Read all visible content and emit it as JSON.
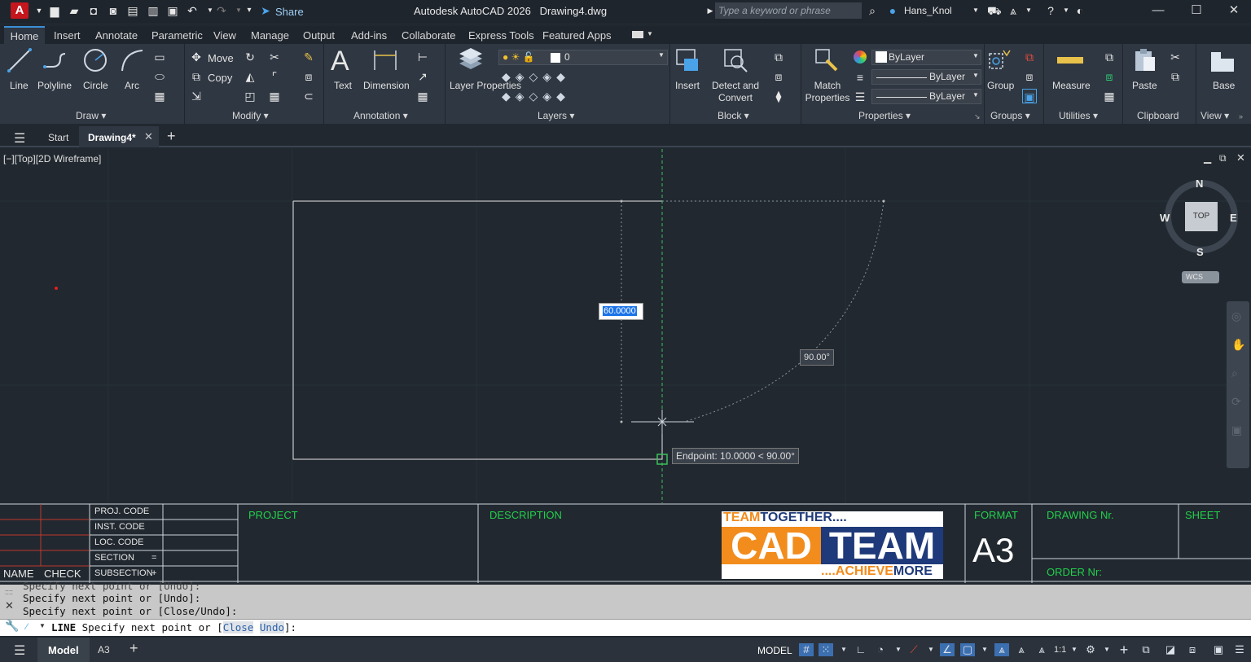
{
  "titlebar": {
    "logo": "A",
    "share_label": "Share",
    "app_title": "Autodesk AutoCAD 2026",
    "file_name": "Drawing4.dwg",
    "search_placeholder": "Type a keyword or phrase",
    "user_name": "Hans_Knol"
  },
  "tabs": [
    "Home",
    "Insert",
    "Annotate",
    "Parametric",
    "View",
    "Manage",
    "Output",
    "Add-ins",
    "Collaborate",
    "Express Tools",
    "Featured Apps"
  ],
  "ribbon": {
    "draw": {
      "title": "Draw",
      "line": "Line",
      "polyline": "Polyline",
      "circle": "Circle",
      "arc": "Arc"
    },
    "modify": {
      "title": "Modify",
      "move": "Move",
      "copy": "Copy"
    },
    "annotation": {
      "title": "Annotation",
      "text": "Text",
      "dimension": "Dimension"
    },
    "layers": {
      "title": "Layers",
      "layer_properties": "Layer Properties",
      "current_layer": "0"
    },
    "block": {
      "title": "Block",
      "insert": "Insert",
      "detect_convert": "Detect and Convert"
    },
    "properties": {
      "title": "Properties",
      "match_properties": "Match Properties",
      "color": "ByLayer",
      "linetype": "ByLayer",
      "lineweight": "ByLayer"
    },
    "groups": {
      "title": "Groups",
      "group": "Group"
    },
    "utilities": {
      "title": "Utilities",
      "measure": "Measure"
    },
    "clipboard": {
      "title": "Clipboard",
      "paste": "Paste"
    },
    "view": {
      "title": "View",
      "base": "Base"
    }
  },
  "doctabs": {
    "start": "Start",
    "drawing": "Drawing4*"
  },
  "viewport": {
    "label": "[−][Top][2D Wireframe]",
    "dynamic_input": "60.0000",
    "angle_tooltip": "90.00°",
    "snap_tooltip": "Endpoint: 10.0000 < 90.00°",
    "viewcube": {
      "n": "N",
      "s": "S",
      "e": "E",
      "w": "W",
      "face": "TOP",
      "wcs": "WCS"
    }
  },
  "titleblock": {
    "proj_code": "PROJ. CODE",
    "inst_code": "INST. CODE",
    "loc_code": "LOC. CODE",
    "section": "SECTION",
    "section_mark": "=",
    "subsection": "SUBSECTION",
    "subsection_mark": "+",
    "name": "NAME",
    "check": "CHECK",
    "project": "PROJECT",
    "description": "DESCRIPTION",
    "logo_top_a": "TEAM",
    "logo_top_b": "TOGETHER....",
    "logo_cad": "CAD",
    "logo_team": "TEAM",
    "logo_bottom_a": "....ACHIEVE",
    "logo_bottom_b": "MORE",
    "format": "FORMAT",
    "format_value": "A3",
    "drawing_nr": "DRAWING Nr.",
    "sheet": "SHEET",
    "order_nr": "ORDER Nr:"
  },
  "command": {
    "history": [
      "Specify next point or [Undo]:",
      "Specify next point or [Undo]:",
      "Specify next point or [Close/Undo]:"
    ],
    "prompt_cmd": "LINE",
    "prompt_text": "Specify next point or [",
    "opt_close": "Close",
    "opt_undo": "Undo",
    "prompt_end": "]:"
  },
  "statusbar": {
    "model_tab": "Model",
    "layout_tab": "A3",
    "model_label": "MODEL",
    "scale": "1:1"
  }
}
